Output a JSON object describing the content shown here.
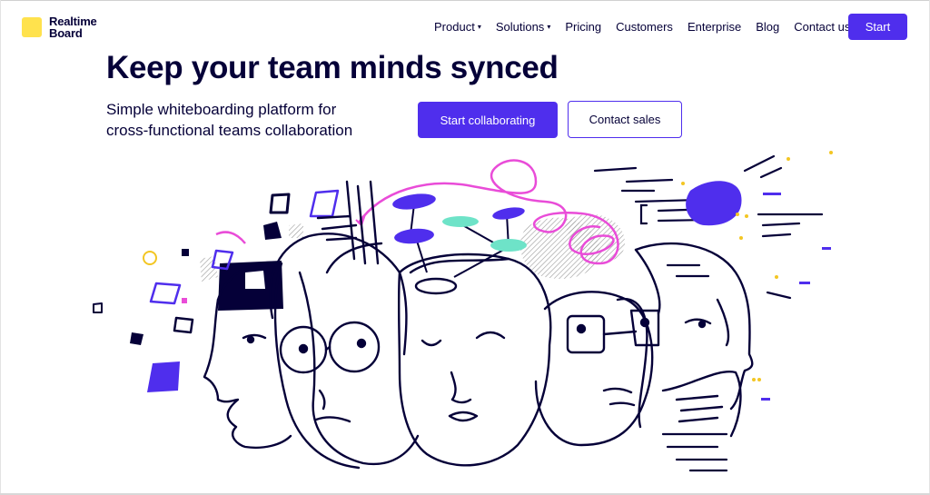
{
  "brand": {
    "line1": "Realtime",
    "line2": "Board"
  },
  "nav": {
    "items": [
      {
        "label": "Product",
        "has_dropdown": true
      },
      {
        "label": "Solutions",
        "has_dropdown": true
      },
      {
        "label": "Pricing",
        "has_dropdown": false
      },
      {
        "label": "Customers",
        "has_dropdown": false
      },
      {
        "label": "Enterprise",
        "has_dropdown": false
      },
      {
        "label": "Blog",
        "has_dropdown": false
      },
      {
        "label": "Contact us",
        "has_dropdown": false
      }
    ],
    "caret": "▾",
    "start_label": "Start"
  },
  "hero": {
    "title": "Keep your team minds synced",
    "subtitle_line1": "Simple whiteboarding platform for",
    "subtitle_line2": "cross-functional teams collaboration",
    "primary_cta": "Start collaborating",
    "secondary_cta": "Contact sales"
  },
  "colors": {
    "brand_yellow": "#ffe24d",
    "accent_purple": "#4f2eed",
    "pink": "#e94cd8",
    "teal": "#6ee3c8",
    "ink": "#050038"
  },
  "icons": {
    "logo": "realtimeboard-logo-square",
    "dropdown": "chevron-down-icon"
  }
}
